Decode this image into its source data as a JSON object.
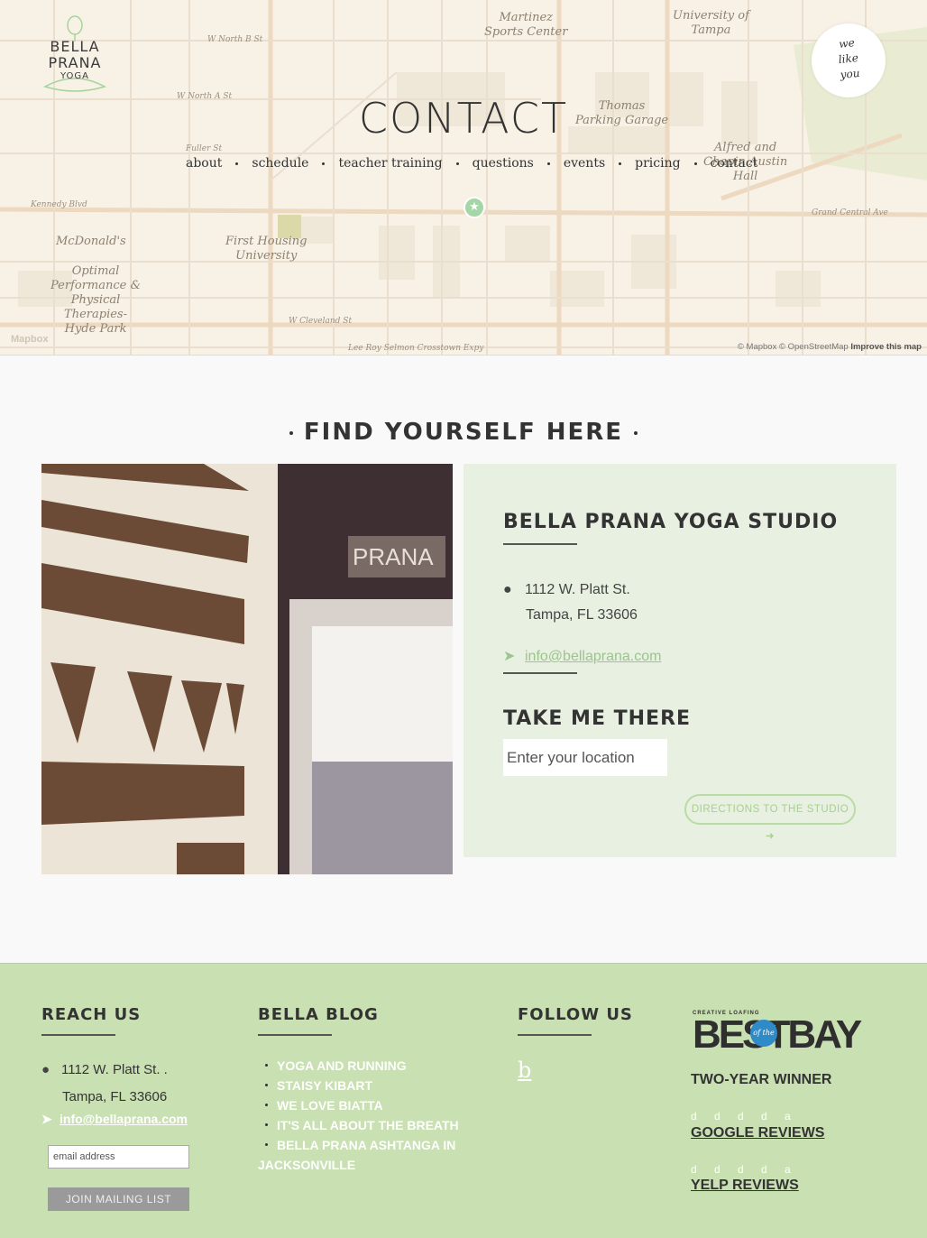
{
  "header": {
    "logo": {
      "line1": "BELLA",
      "line2": "PRANA",
      "line3": "YOGA"
    },
    "we_like_you": [
      "we",
      "like",
      "you"
    ],
    "page_title": "CONTACT",
    "nav": [
      "about",
      "schedule",
      "teacher training",
      "questions",
      "events",
      "pricing",
      "contact"
    ]
  },
  "map": {
    "labels": {
      "martinez": "Martinez\nSports Center",
      "university": "University of\nTampa",
      "thomas": "Thomas\nParking Garage",
      "alfred": "Alfred and\nChapin Austin\nHall",
      "mcdonalds": "McDonald's",
      "optimal": "Optimal\nPerformance &\nPhysical\nTherapies-\nHyde Park",
      "first_housing": "First Housing\nUniversity",
      "w_north_b": "W North B St",
      "w_north_a": "W North A St",
      "kennedy": "Kennedy Blvd",
      "cleveland": "W Cleveland St",
      "grand_central": "Grand Central Ave",
      "lee_roy": "Lee Roy Selmon Crosstown Expy",
      "fuller": "Fuller St"
    },
    "logo_text": "Mapbox",
    "attribution": {
      "part1": "© Mapbox © OpenStreetMap",
      "improve": "Improve this map"
    }
  },
  "main": {
    "section_title": "FIND YOURSELF HERE",
    "photo_sign": "PRANA",
    "studio_name": "BELLA PRANA YOGA STUDIO",
    "address_line1": "1112 W. Platt St.",
    "address_line2": "Tampa, FL 33606",
    "email": "info@bellaprana.com",
    "take_me_there": "TAKE ME THERE",
    "location_placeholder": "Enter your location",
    "directions_button": "DIRECTIONS TO THE STUDIO ➜"
  },
  "footer": {
    "reach_us": {
      "title": "REACH US",
      "address_line1": "1112 W. Platt St. .",
      "address_line2": "Tampa, FL 33606",
      "email": "info@bellaprana.com",
      "email_placeholder": "email address",
      "join_button": "JOIN MAILING LIST"
    },
    "blog": {
      "title": "BELLA BLOG",
      "posts": [
        "YOGA AND RUNNING",
        "STAISY KIBART",
        "WE LOVE BIATTA",
        "IT'S ALL ABOUT THE BREATH",
        "BELLA PRANA ASHTANGA IN JACKSONVILLE"
      ]
    },
    "follow": {
      "title": "FOLLOW US",
      "icon_letter": "b"
    },
    "awards": {
      "creative_loafing": "CREATIVE LOAFING",
      "best": "BEST",
      "of_the": "of the",
      "bay": "BAY",
      "two_year": "TWO-YEAR WINNER",
      "stars_text": "d d d d a",
      "google": "GOOGLE REVIEWS",
      "yelp": "YELP REVIEWS"
    }
  },
  "colors": {
    "accent_green": "#9cc48c",
    "footer_bg": "#c9e0b2",
    "info_bg": "#e7f0e1"
  }
}
